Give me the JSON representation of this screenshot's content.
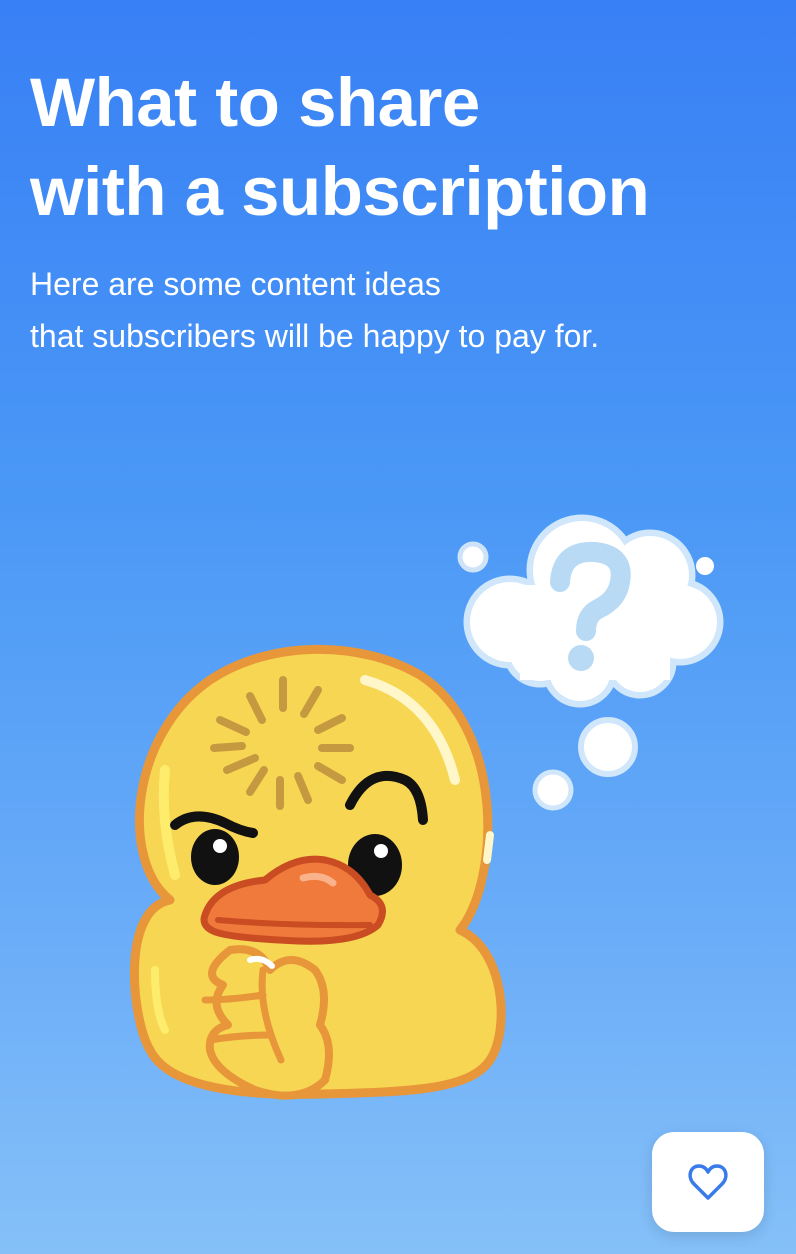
{
  "header": {
    "title_line1": "What to share",
    "title_line2": "with a subscription",
    "subtitle_line1": "Here are some content ideas",
    "subtitle_line2": "that subscribers will be happy to pay for."
  },
  "illustration": {
    "icon": "thinking-duck-icon",
    "bubble_icon": "question-cloud-icon"
  },
  "fab": {
    "icon": "heart-icon"
  },
  "colors": {
    "background_top": "#3880f5",
    "background_bottom": "#85c0f8",
    "duck_body": "#f7d653",
    "duck_outline": "#e8963a",
    "beak": "#ef7a3b",
    "accent": "#3a7bea"
  }
}
